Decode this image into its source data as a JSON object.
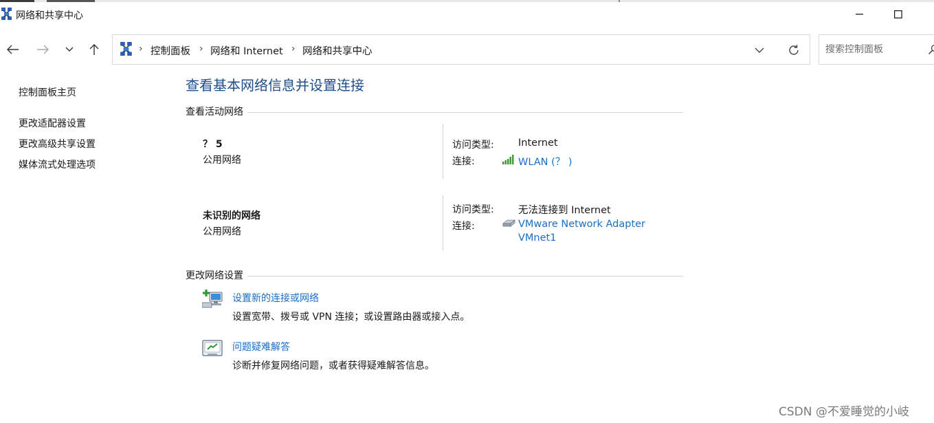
{
  "window": {
    "title": "网络和共享中心",
    "minimize_glyph": "—",
    "maximize_glyph": "☐"
  },
  "nav": {
    "breadcrumb": [
      "控制面板",
      "网络和 Internet",
      "网络和共享中心"
    ],
    "separator": "›",
    "search_placeholder": "搜索控制面板"
  },
  "sidebar": {
    "items": [
      {
        "label": "控制面板主页"
      },
      {
        "label": "更改适配器设置"
      },
      {
        "label": "更改高级共享设置"
      },
      {
        "label": "媒体流式处理选项"
      }
    ]
  },
  "main": {
    "title": "查看基本网络信息并设置连接",
    "active_networks_header": "查看活动网络",
    "networks": [
      {
        "name": "？ 5",
        "type": "公用网络",
        "access_label": "访问类型:",
        "access_value": "Internet",
        "connection_label": "连接:",
        "connection_value": "WLAN (？ )",
        "connection_icon": "wifi-signal-icon"
      },
      {
        "name": "未识别的网络",
        "type": "公用网络",
        "access_label": "访问类型:",
        "access_value": "无法连接到 Internet",
        "connection_label": "连接:",
        "connection_value_line1": "VMware Network Adapter",
        "connection_value_line2": "VMnet1",
        "connection_icon": "ethernet-adapter-icon"
      }
    ],
    "change_settings_header": "更改网络设置",
    "tasks": [
      {
        "link": "设置新的连接或网络",
        "description": "设置宽带、拨号或 VPN 连接；或设置路由器或接入点。",
        "icon": "new-connection-icon"
      },
      {
        "link": "问题疑难解答",
        "description": "诊断并修复网络问题，或者获得疑难解答信息。",
        "icon": "troubleshoot-icon"
      }
    ]
  },
  "watermark": "CSDN @不爱睡觉的小岐",
  "colors": {
    "title_blue": "#1f4e8c",
    "link_blue": "#1a6fc4",
    "divider": "#d4d4d4"
  }
}
